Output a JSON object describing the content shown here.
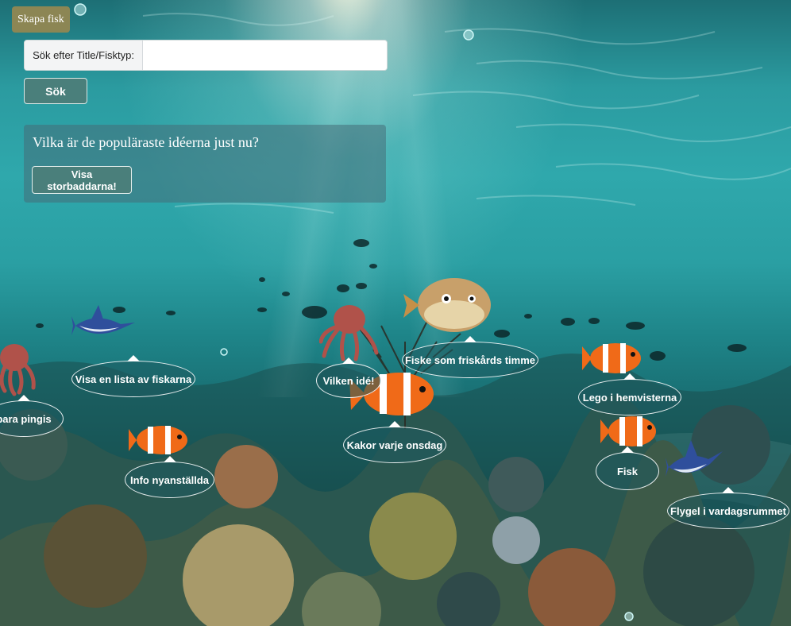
{
  "header": {
    "create_fish_label": "Skapa fisk"
  },
  "search": {
    "label": "Sök efter Title/Fisktyp:",
    "value": "",
    "placeholder": "",
    "button_label": "Sök"
  },
  "popular": {
    "title": "Vilka är de populäraste idéerna just nu?",
    "button_label": "Visa storbaddarna!"
  },
  "fish_ideas": [
    {
      "label": "bara pingis",
      "creature": "octopus-icon"
    },
    {
      "label": "Visa en lista av fiskarna",
      "creature": "swordfish-icon"
    },
    {
      "label": "Info nyanställda",
      "creature": "clownfish-icon"
    },
    {
      "label": "Vilken idé!",
      "creature": "octopus-icon"
    },
    {
      "label": "Fiske som friskårds timme",
      "creature": "pufferfish-icon"
    },
    {
      "label": "Kakor varje onsdag",
      "creature": "clownfish-icon"
    },
    {
      "label": "Lego i hemvisterna",
      "creature": "clownfish-icon"
    },
    {
      "label": "Fisk",
      "creature": "clownfish-icon"
    },
    {
      "label": "Flygel i vardagsrummet",
      "creature": "swordfish-icon"
    }
  ],
  "colors": {
    "create_button": "#8c8654",
    "button_teal": "#4a7f7b",
    "water": "#2a9fa3",
    "clownfish_orange": "#f06a18",
    "octopus": "#b0524a"
  }
}
